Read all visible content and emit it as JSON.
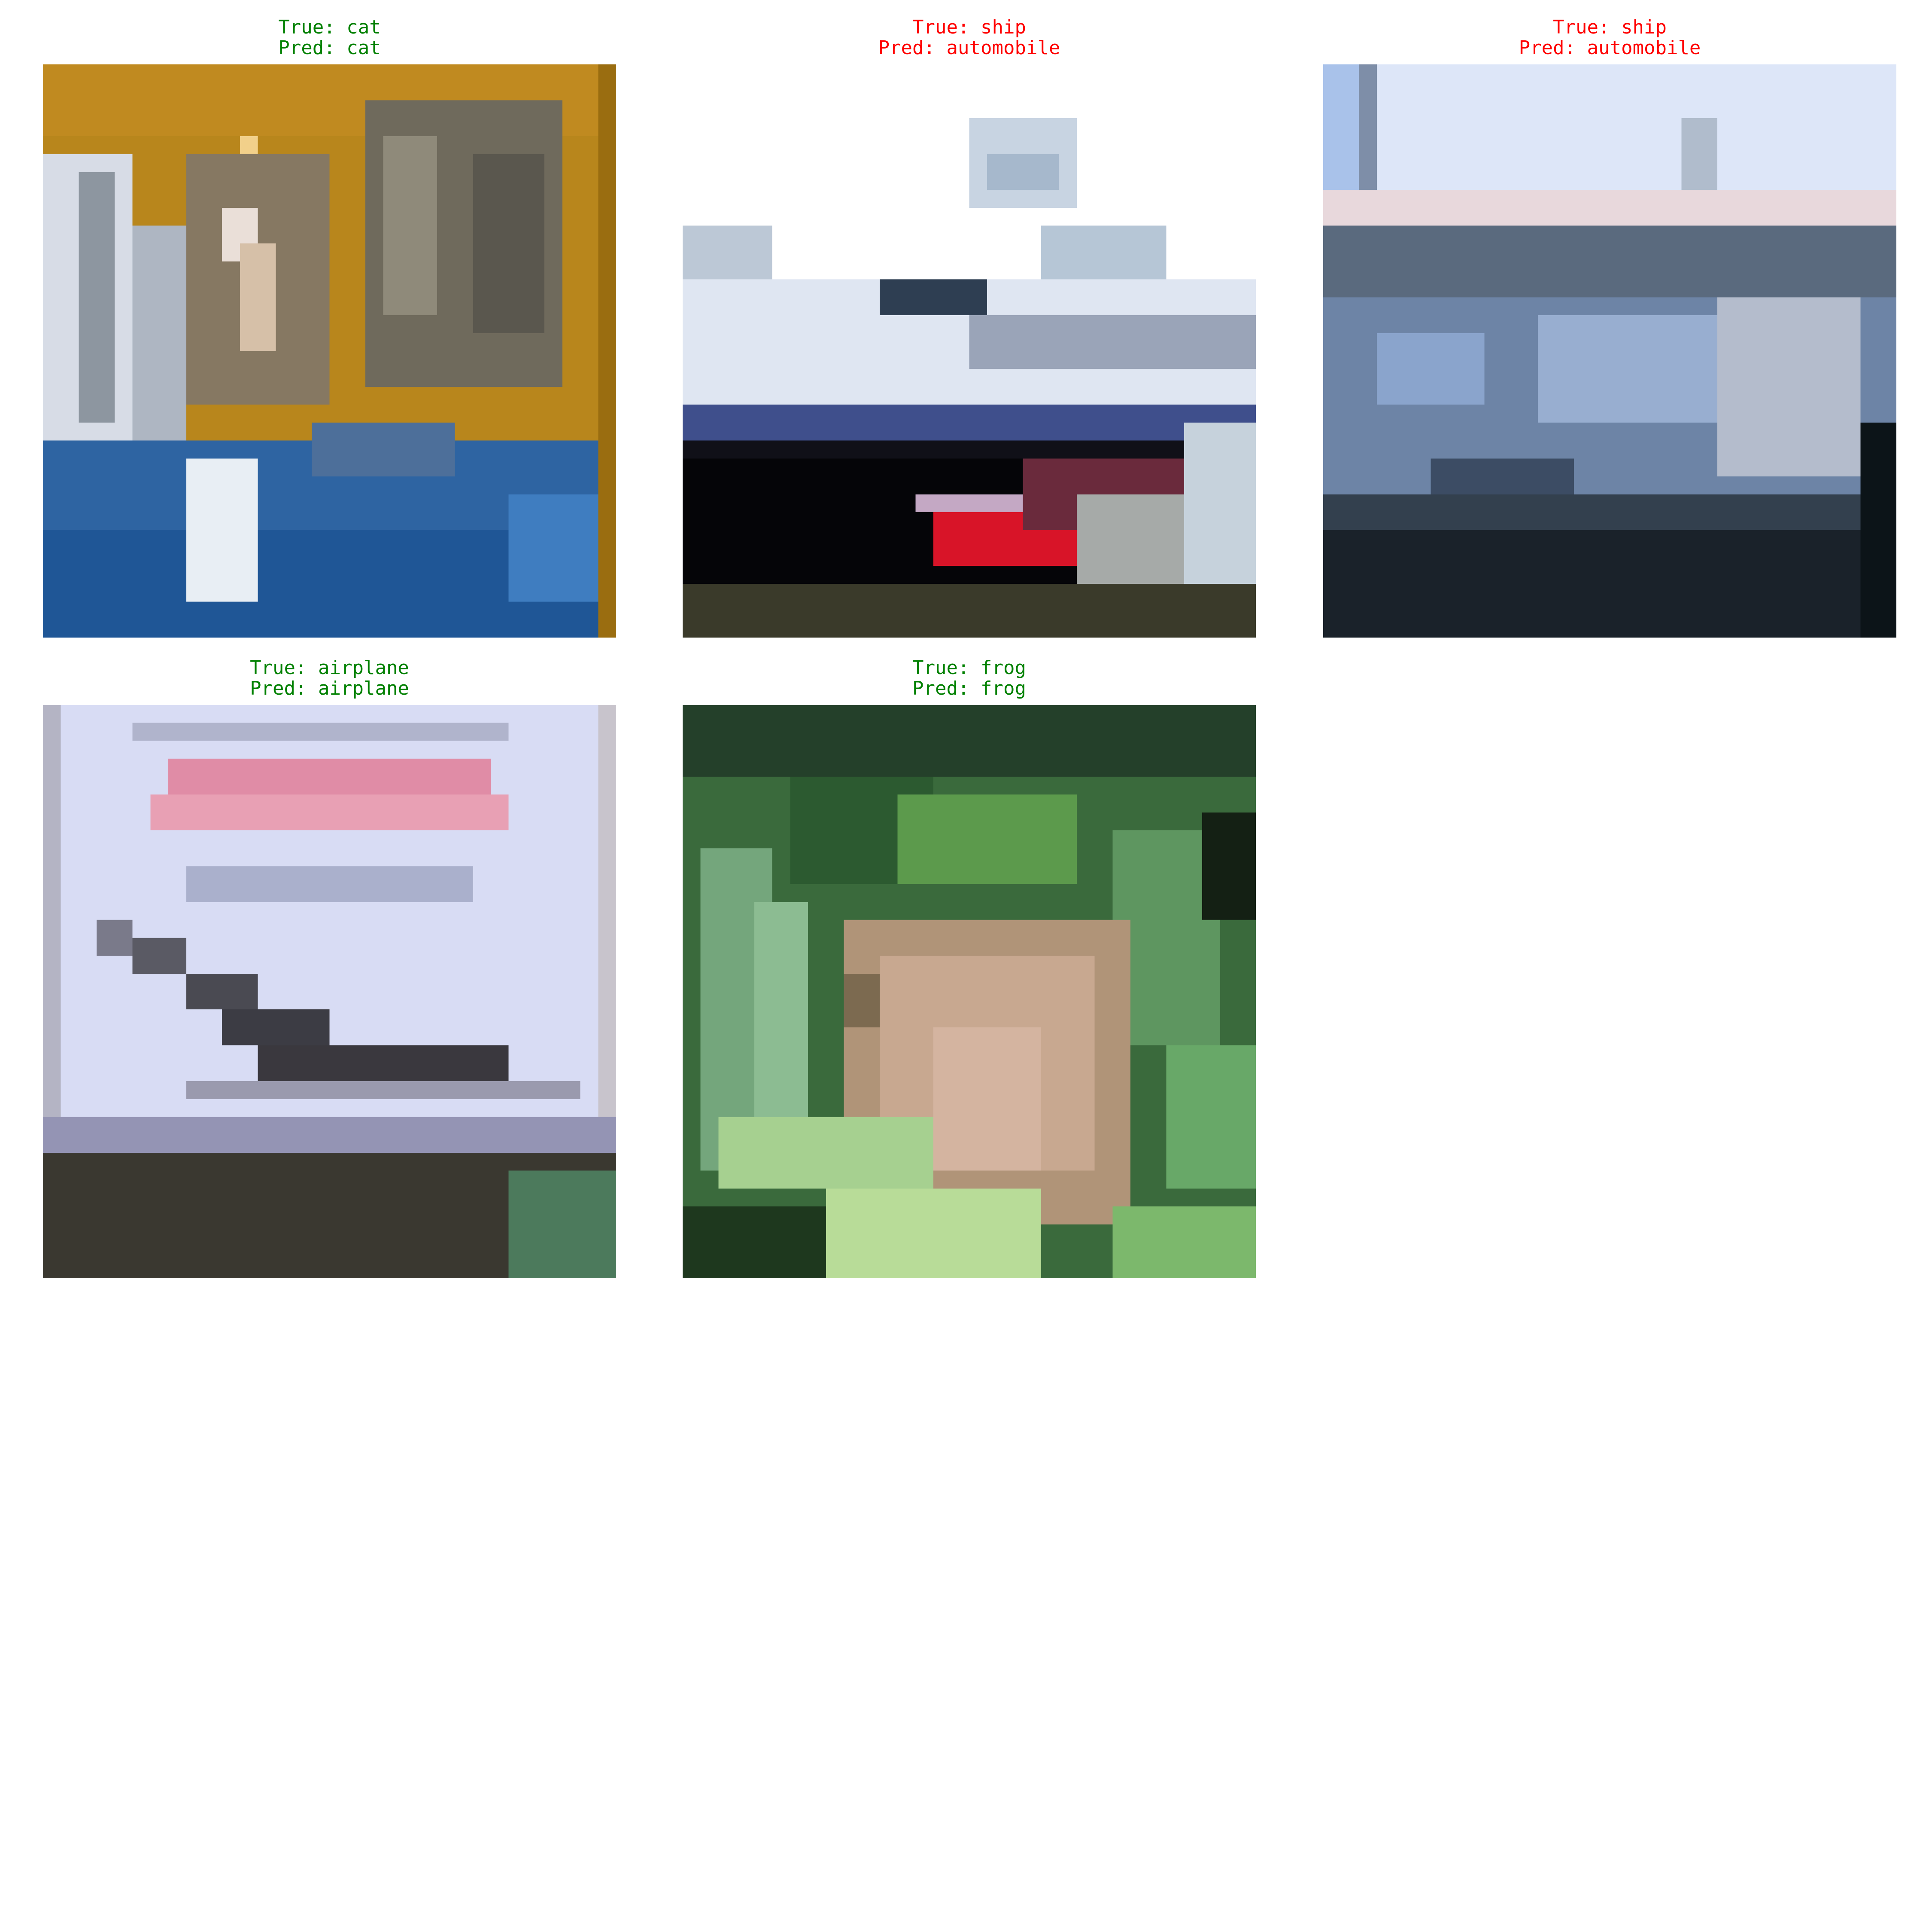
{
  "colors": {
    "correct": "#008000",
    "incorrect": "#ff0000"
  },
  "panels": [
    {
      "true_label": "True: cat",
      "pred_label": "Pred: cat",
      "correct": true,
      "subject": "cat"
    },
    {
      "true_label": "True: ship",
      "pred_label": "Pred: automobile",
      "correct": false,
      "subject": "ship"
    },
    {
      "true_label": "True: ship",
      "pred_label": "Pred: automobile",
      "correct": false,
      "subject": "ship"
    },
    {
      "true_label": "True: airplane",
      "pred_label": "Pred: airplane",
      "correct": true,
      "subject": "airplane"
    },
    {
      "true_label": "True: frog",
      "pred_label": "Pred: frog",
      "correct": true,
      "subject": "frog"
    }
  ]
}
